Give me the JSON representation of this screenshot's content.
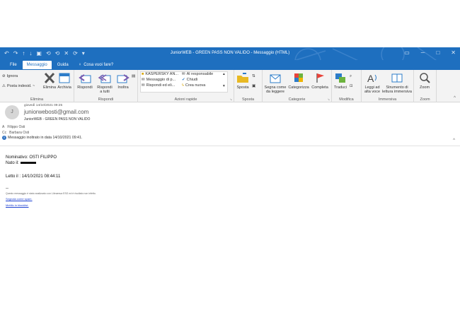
{
  "window": {
    "title": "JuniorWEB - GREEN PASS NON VALIDO - Messaggio (HTML)"
  },
  "tabs": [
    {
      "label": "File"
    },
    {
      "label": "Messaggio"
    },
    {
      "label": "Guida"
    }
  ],
  "tell_me": {
    "label": "Cosa vuoi fare?"
  },
  "ribbon": {
    "elimina_group": {
      "label": "Elimina",
      "ignora": "Ignora",
      "posta_indesid": "Posta indesid. ~",
      "elimina": "Elimina",
      "archivia": "Archivia"
    },
    "rispondi_group": {
      "label": "Rispondi",
      "rispondi": "Rispondi",
      "rispondi_tutti_1": "Rispondi",
      "rispondi_tutti_2": "a tutti",
      "inoltra": "Inoltra"
    },
    "azioni_group": {
      "label": "Azioni rapide",
      "items": [
        "KASPERSKY AN...",
        "Messaggio di p...",
        "Rispondi ed eli...",
        "Al responsabile",
        "Chiudi",
        "Crea nuova"
      ]
    },
    "sposta_group": {
      "label": "Sposta",
      "sposta": "Sposta"
    },
    "categorie_group": {
      "label": "Categorie",
      "segna_1": "Segna come",
      "segna_2": "da leggere",
      "categorizza": "Categorizza",
      "completa": "Completa"
    },
    "modifica_group": {
      "label": "Modifica",
      "traduci": "Traduci"
    },
    "immersiva_group": {
      "label": "Immersiva",
      "leggi_1": "Leggi ad",
      "leggi_2": "alta voce",
      "strumento_1": "Strumento di",
      "strumento_2": "lettura immersiva"
    },
    "zoom_group": {
      "label": "Zoom",
      "zoom": "Zoom"
    }
  },
  "message": {
    "avatar_letter": "J",
    "date": "giovedì 14/10/2021 09:25",
    "sender": "juniorwebosti@gmail.com",
    "subject": "JuniorWEB - GREEN PASS NON VALIDO",
    "to_label": "A",
    "to": "Filippo Osti",
    "cc_label": "Cc",
    "cc": "Barbara Osti",
    "info": "Messaggio inoltrato in data 14/10/2021 09:41."
  },
  "body": {
    "nominativo": "Nominativo: OSTI FILIPPO",
    "nato": "Nato il:",
    "letto": "Letto il : 14/10/2021 08:44:11",
    "separator": "--",
    "disclaimer": "Questo messaggio è stato analizzato con Libraesva ESG ed è risultato non infetto.",
    "link1": "Segnala come spam.",
    "link2": "Mettilo in blacklist."
  },
  "colors": {
    "brand_blue": "#1e6fbf",
    "ribbon_bg": "#f3f3f3",
    "link": "#1b3fd1"
  }
}
